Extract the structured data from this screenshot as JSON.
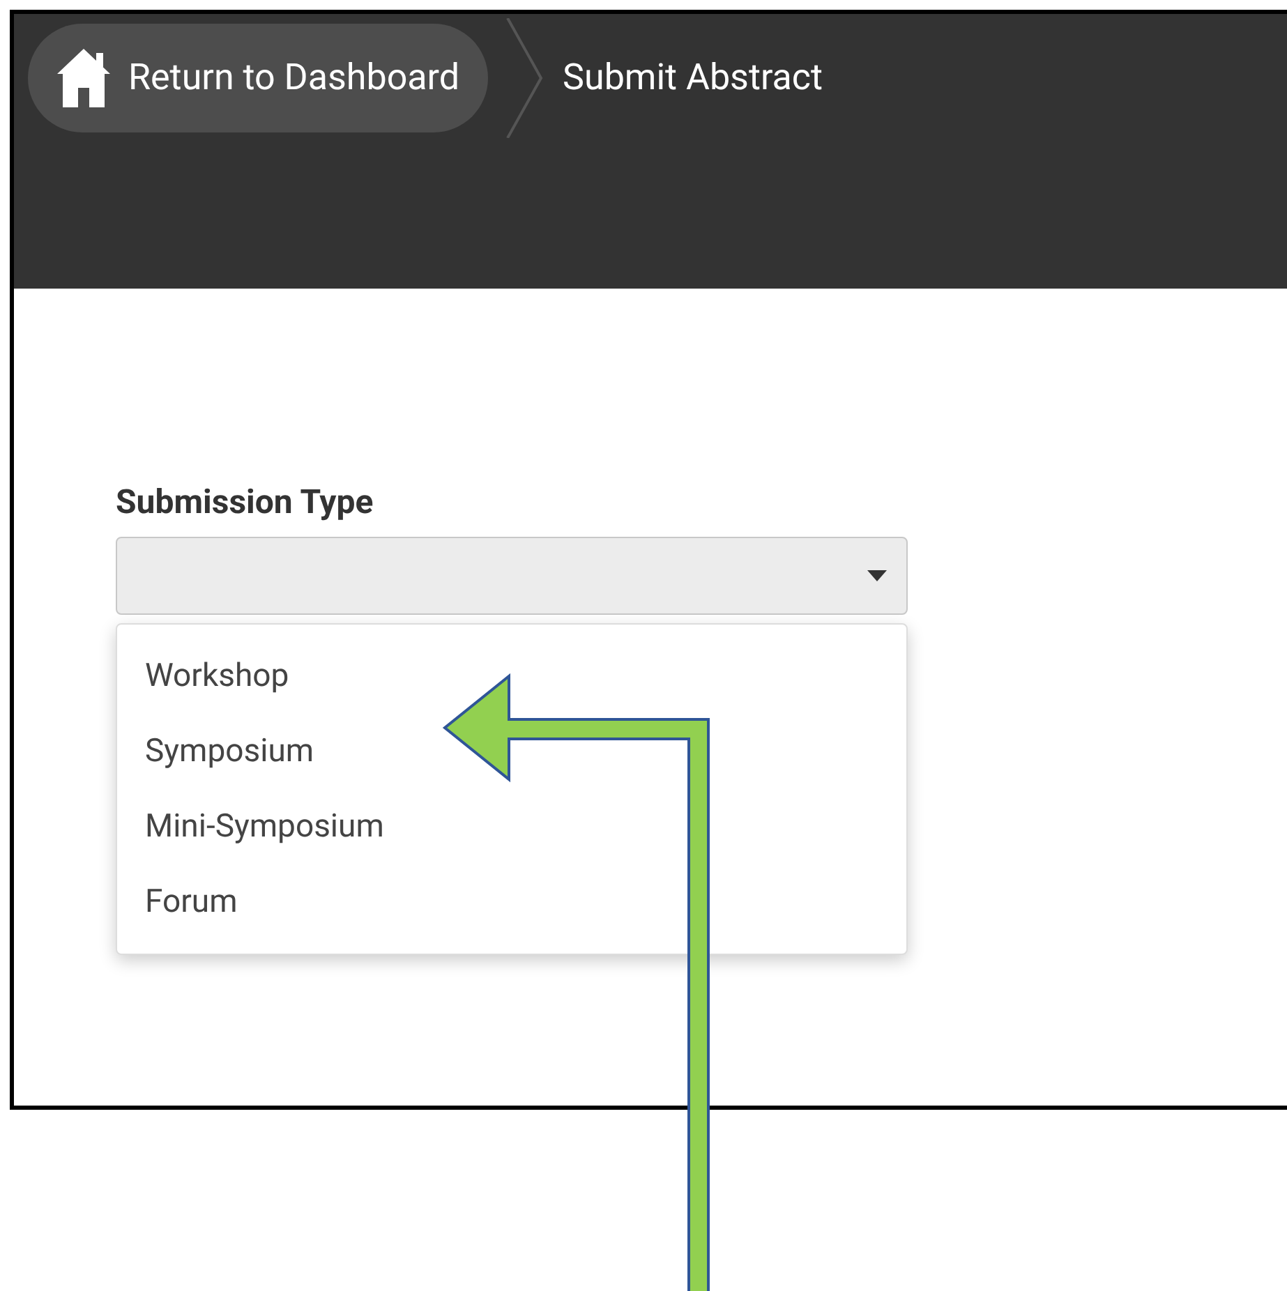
{
  "header": {
    "breadcrumbs": [
      {
        "label": "Return to Dashboard",
        "kind": "link"
      },
      {
        "label": "Submit Abstract",
        "kind": "current"
      }
    ]
  },
  "form": {
    "label": "Submission Type",
    "select": {
      "expanded": true,
      "options": [
        {
          "label": "Workshop",
          "selected": false
        },
        {
          "label": "Symposium",
          "selected": false
        },
        {
          "label": "Mini-Symposium",
          "selected": false
        },
        {
          "label": "Forum",
          "selected": false
        }
      ]
    }
  }
}
